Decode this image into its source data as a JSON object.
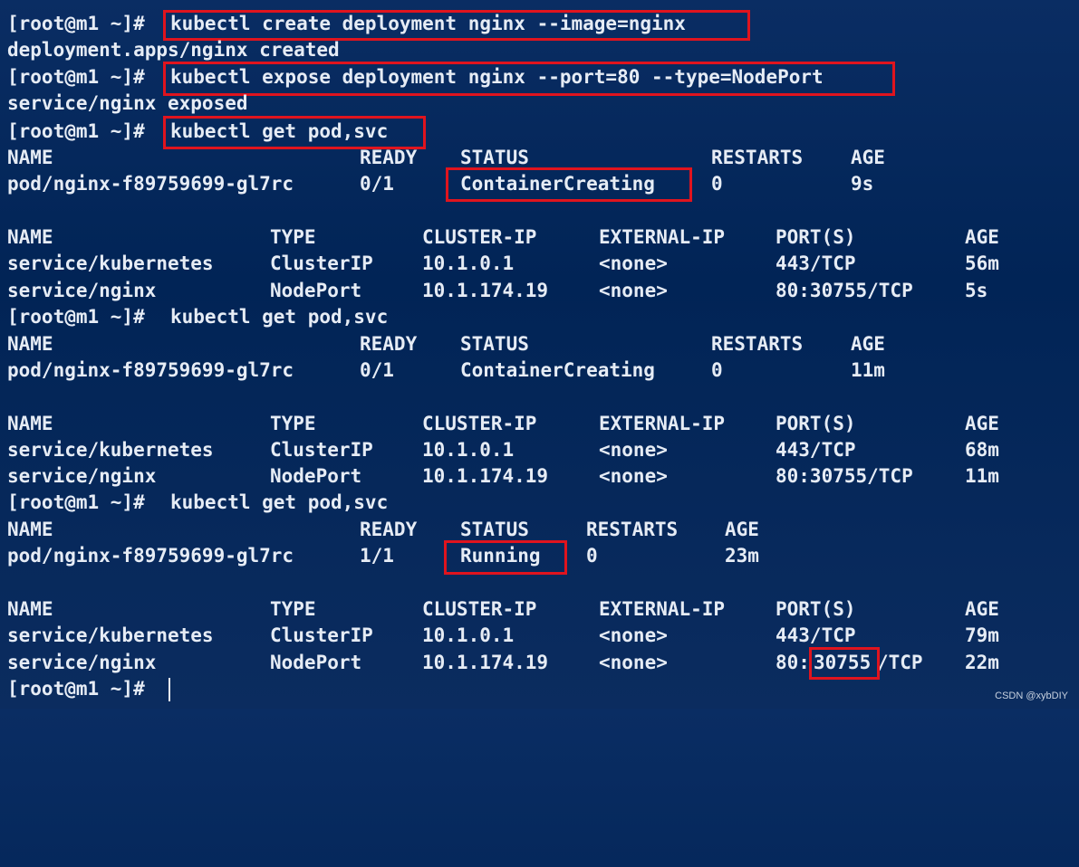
{
  "prompt": "[root@m1 ~]#",
  "commands": {
    "create": "kubectl create deployment nginx --image=nginx",
    "expose": "kubectl expose deployment nginx --port=80 --type=NodePort",
    "get": "kubectl get pod,svc"
  },
  "outputs": {
    "created": "deployment.apps/nginx created",
    "exposed": "service/nginx exposed"
  },
  "pod_headers": {
    "name": "NAME",
    "ready": "READY",
    "status": "STATUS",
    "restarts": "RESTARTS",
    "age": "AGE"
  },
  "svc_headers": {
    "name": "NAME",
    "type": "TYPE",
    "cluster_ip": "CLUSTER-IP",
    "external_ip": "EXTERNAL-IP",
    "ports": "PORT(S)",
    "age": "AGE"
  },
  "snapshots": [
    {
      "pod": {
        "name": "pod/nginx-f89759699-gl7rc",
        "ready": "0/1",
        "status": "ContainerCreating",
        "restarts": "0",
        "age": "9s"
      },
      "services": [
        {
          "name": "service/kubernetes",
          "type": "ClusterIP",
          "cluster_ip": "10.1.0.1",
          "external_ip": "<none>",
          "ports": "443/TCP",
          "age": "56m"
        },
        {
          "name": "service/nginx",
          "type": "NodePort",
          "cluster_ip": "10.1.174.19",
          "external_ip": "<none>",
          "ports": "80:30755/TCP",
          "age": "5s"
        }
      ]
    },
    {
      "pod": {
        "name": "pod/nginx-f89759699-gl7rc",
        "ready": "0/1",
        "status": "ContainerCreating",
        "restarts": "0",
        "age": "11m"
      },
      "services": [
        {
          "name": "service/kubernetes",
          "type": "ClusterIP",
          "cluster_ip": "10.1.0.1",
          "external_ip": "<none>",
          "ports": "443/TCP",
          "age": "68m"
        },
        {
          "name": "service/nginx",
          "type": "NodePort",
          "cluster_ip": "10.1.174.19",
          "external_ip": "<none>",
          "ports": "80:30755/TCP",
          "age": "11m"
        }
      ]
    },
    {
      "pod": {
        "name": "pod/nginx-f89759699-gl7rc",
        "ready": "1/1",
        "status": "Running",
        "restarts": "0",
        "age": "23m"
      },
      "services": [
        {
          "name": "service/kubernetes",
          "type": "ClusterIP",
          "cluster_ip": "10.1.0.1",
          "external_ip": "<none>",
          "ports": "443/TCP",
          "age": "79m"
        },
        {
          "name": "service/nginx",
          "type": "NodePort",
          "cluster_ip": "10.1.174.19",
          "external_ip": "<none>",
          "ports_prefix": "80:",
          "ports_highlight": "30755",
          "ports_suffix": "/TCP",
          "age": "22m"
        }
      ]
    }
  ],
  "watermark": "CSDN @xybDIY",
  "colors": {
    "background": "#012456",
    "text": "#e6ecf5",
    "highlight_box": "#e0141e"
  }
}
